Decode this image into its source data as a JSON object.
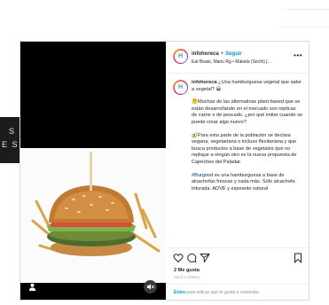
{
  "side_panel": {
    "line1": "S",
    "line2": "E S"
  },
  "post": {
    "account": "infohoreca",
    "dot": "•",
    "follow_label": "Seguir",
    "subtitle": "Eat Beats, Manu Rg • Maketa (Sechi) [...",
    "more": "•••",
    "avatar_letter": "H",
    "caption": {
      "intro_user": "infohoreca",
      "intro_text": " ¿Una hamburguesa vegetal que sabe a vegetal? 😀",
      "p1": "🤔Muchas de las alternativas plant-based que se están desarrollando en el mercado son réplicas de carne o de pescado. ¿por qué imitar cuando se puede crear algo nuevo?",
      "p2": "🥑Para esta parte de la población se declara vegana, vegetariana o incluso flexitariana y que busca productos a base de vegetales que no replique a ningún otro es la nueva propuesta de Capriches del Paladar.",
      "p3_tag": "#Burgood",
      "p3_text": " es una hamburguesa a base de alcachofas frescas y nada más. Sólo alcachofa triturada. ADVE y espeante natural"
    },
    "likes": "2 Me gusta",
    "date": "HACE 2 HORAS",
    "comment_login": "Entra",
    "comment_rest": " para indicar que te gusta o comentar."
  },
  "colors": {
    "link": "#0095f6",
    "hashtag": "#00376b",
    "border": "#dbdbdb",
    "media_bg": "#000000"
  },
  "icons": [
    "user-icon",
    "sound-off-icon",
    "heart-icon",
    "comment-icon",
    "share-icon",
    "bookmark-icon",
    "more-icon"
  ]
}
